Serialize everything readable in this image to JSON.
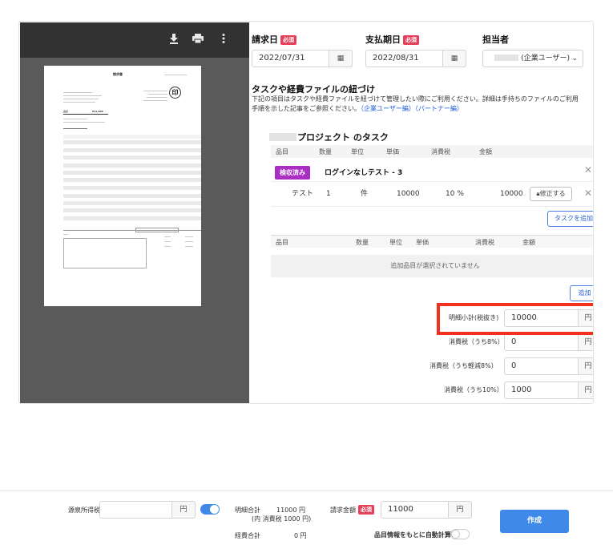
{
  "pdf": {
    "icons": [
      "download-icon",
      "print-icon",
      "more-vertical-icon"
    ],
    "doc_title": "請求書",
    "stamp": "印",
    "total_label": "合計",
    "total_value": "¥11,000"
  },
  "form": {
    "invoice_date": {
      "label": "請求日",
      "required": "必須",
      "value": "2022/07/31"
    },
    "due_date": {
      "label": "支払期日",
      "required": "必須",
      "value": "2022/08/31"
    },
    "assignee": {
      "label": "担当者",
      "value": "(企業ユーザー)"
    },
    "link_section": {
      "title": "タスクや経費ファイルの紐づけ",
      "desc1": "下記の項目はタスクや経費ファイルを紐づけて管理したい際にご利用ください。詳細は手持ちのファイルのご利用",
      "desc2": "手順を示した記事をご参照ください。",
      "link1": "（企業ユーザー編）",
      "link2": "（パートナー編）"
    },
    "project_title": "プロジェクト のタスク",
    "table_headers": [
      "品目",
      "数量",
      "単位",
      "単価",
      "消費税",
      "金額"
    ],
    "task": {
      "badge": "検収済み",
      "name": "ログインなしテスト - 3",
      "item": "テスト",
      "qty": "1",
      "unit": "件",
      "price": "10000",
      "tax": "10 %",
      "amount": "10000",
      "edit_button": "修正する"
    },
    "add_task_button": "タスクを追加",
    "items_headers": [
      "品目",
      "数量",
      "単位",
      "単価",
      "消費税",
      "金額"
    ],
    "no_items_text": "追加品目が選択されていません",
    "add_button": "追加",
    "subtotal_label": "明細小計(税抜き)",
    "subtotal_value": "10000",
    "tax8_label": "消費税（うち8%）",
    "tax8_value": "0",
    "tax_reduced_label": "消費税（うち軽減8%）",
    "tax_reduced_value": "0",
    "tax10_label": "消費税（うち10%）",
    "tax10_value": "1000",
    "yen": "円"
  },
  "footer": {
    "withholding_label": "源泉所得税",
    "withholding_value": "",
    "yen": "円",
    "detail_total_label": "明細合計",
    "detail_total_value": "11000 円",
    "detail_tax_note": "(内 消費税 1000 円)",
    "expense_label": "経費合計",
    "expense_value": "0 円",
    "invoice_amount_label": "請求金額",
    "required": "必須",
    "invoice_amount_value": "11000",
    "auto_calc_label": "品目情報をもとに自動計算",
    "create_button": "作成"
  },
  "colors": {
    "accent": "#3f8ae8",
    "required": "#e4405a",
    "badge": "#a92ec2",
    "highlight": "#f2311d"
  }
}
